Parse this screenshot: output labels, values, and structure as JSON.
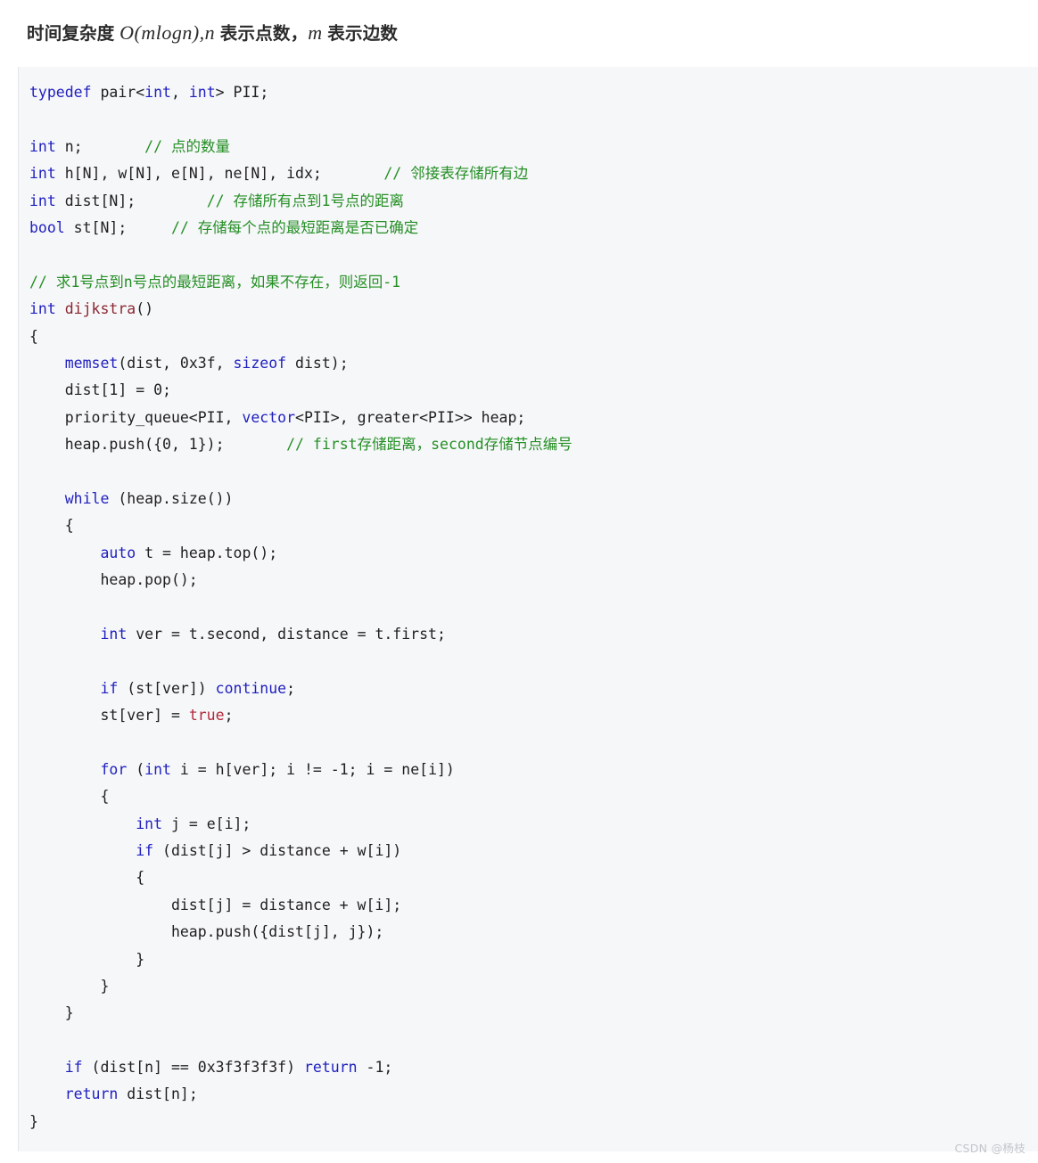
{
  "page": {
    "background_color": "#ffffff"
  },
  "title": {
    "prefix": "时间复杂度 ",
    "formula_1": "O(mlogn),",
    "var_n": "n",
    "mid": " 表示点数，",
    "var_m": "m",
    "suffix": " 表示边数",
    "full_text": "时间复杂度 O(mlogn), n 表示点数， m 表示边数"
  },
  "code_block": {
    "language": "cpp",
    "background_color": "#f6f7f9",
    "border_color": "#e3e5e8",
    "colors": {
      "keyword": "#1f1fbf",
      "comment": "#258f25",
      "function": "#8b2731",
      "constant": "#b2293a",
      "plain": "#1f1f1f"
    },
    "lines": [
      "typedef pair<int, int> PII;",
      "",
      "int n;       // 点的数量",
      "int h[N], w[N], e[N], ne[N], idx;       // 邻接表存储所有边",
      "int dist[N];        // 存储所有点到1号点的距离",
      "bool st[N];     // 存储每个点的最短距离是否已确定",
      "",
      "// 求1号点到n号点的最短距离，如果不存在，则返回-1",
      "int dijkstra()",
      "{",
      "    memset(dist, 0x3f, sizeof dist);",
      "    dist[1] = 0;",
      "    priority_queue<PII, vector<PII>, greater<PII>> heap;",
      "    heap.push({0, 1});       // first存储距离，second存储节点编号",
      "",
      "    while (heap.size())",
      "    {",
      "        auto t = heap.top();",
      "        heap.pop();",
      "",
      "        int ver = t.second, distance = t.first;",
      "",
      "        if (st[ver]) continue;",
      "        st[ver] = true;",
      "",
      "        for (int i = h[ver]; i != -1; i = ne[i])",
      "        {",
      "            int j = e[i];",
      "            if (dist[j] > distance + w[i])",
      "            {",
      "                dist[j] = distance + w[i];",
      "                heap.push({dist[j], j});",
      "            }",
      "        }",
      "    }",
      "",
      "    if (dist[n] == 0x3f3f3f3f) return -1;",
      "    return dist[n];",
      "}"
    ]
  },
  "watermark": {
    "text": "CSDN @杨枝"
  }
}
